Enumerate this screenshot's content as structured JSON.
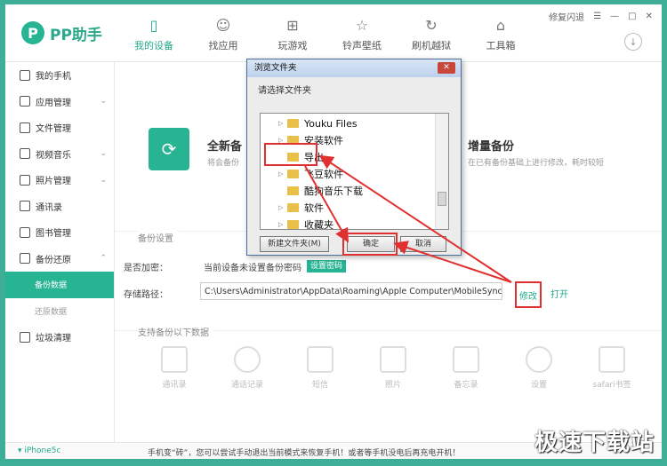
{
  "app": {
    "logo_mark": "P",
    "logo_text": "PP助手"
  },
  "nav": [
    {
      "label": "我的设备",
      "icon": "device-icon"
    },
    {
      "label": "找应用",
      "icon": "apps-icon"
    },
    {
      "label": "玩游戏",
      "icon": "gamepad-icon"
    },
    {
      "label": "铃声壁纸",
      "icon": "ringtone-icon"
    },
    {
      "label": "刷机越狱",
      "icon": "flash-icon"
    },
    {
      "label": "工具箱",
      "icon": "toolbox-icon"
    }
  ],
  "window": {
    "feedback": "修复闪退"
  },
  "sidebar": {
    "items": [
      "我的手机",
      "应用管理",
      "文件管理",
      "视频音乐",
      "照片管理",
      "通讯录",
      "图书管理",
      "备份还原"
    ],
    "sub": [
      "备份数据",
      "还原数据"
    ],
    "last": "垃圾清理"
  },
  "main": {
    "full_title": "全新备",
    "full_desc": "将会备份",
    "inc_title": "增量备份",
    "inc_desc": "在已有备份基础上进行修改，耗时较短",
    "settings_label": "备份设置",
    "encrypt_label": "是否加密：",
    "encrypt_text": "当前设备未设置备份密码",
    "encrypt_button": "设置密码",
    "path_label": "存储路径：",
    "path_value": "C:\\Users\\Administrator\\AppData\\Roaming\\Apple Computer\\MobileSync",
    "modify": "修改",
    "open": "打开",
    "types_label": "支持备份以下数据",
    "types": [
      "通讯录",
      "通话记录",
      "短信",
      "照片",
      "备忘录",
      "设置",
      "safari书签"
    ]
  },
  "dialog": {
    "title": "浏览文件夹",
    "prompt": "请选择文件夹",
    "tree": [
      "Youku Files",
      "安装软件",
      "导出",
      "飞豆软件",
      "酷狗音乐下载",
      "软件",
      "收藏夹"
    ],
    "new_folder": "新建文件夹(M)",
    "ok": "确定",
    "cancel": "取消"
  },
  "footer": {
    "device": "iPhone5c",
    "message": "手机变“砖”，您可以尝试手动退出当前模式来恢复手机！或者等手机没电后再充电开机！"
  },
  "watermark": "极速下载站"
}
